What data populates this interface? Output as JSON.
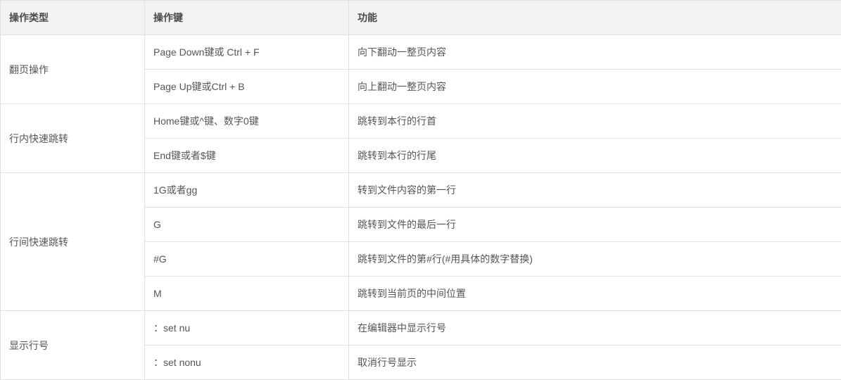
{
  "table": {
    "headers": {
      "type": "操作类型",
      "key": "操作键",
      "func": "功能"
    },
    "groups": [
      {
        "type": "翻页操作",
        "rows": [
          {
            "key": "Page Down键或 Ctrl + F",
            "func": "向下翻动一整页内容"
          },
          {
            "key": "Page Up键或Ctrl + B",
            "func": "向上翻动一整页内容"
          }
        ]
      },
      {
        "type": "行内快速跳转",
        "rows": [
          {
            "key": "Home键或^键、数字0键",
            "func": "跳转到本行的行首"
          },
          {
            "key": "End键或者$键",
            "func": "跳转到本行的行尾"
          }
        ]
      },
      {
        "type": "行间快速跳转",
        "rows": [
          {
            "key": "1G或者gg",
            "func": "转到文件内容的第一行"
          },
          {
            "key": "G",
            "func": "跳转到文件的最后一行"
          },
          {
            "key": "#G",
            "func": "跳转到文件的第#行(#用具体的数字替换)"
          },
          {
            "key": "M",
            "func": "跳转到当前页的中间位置"
          }
        ]
      },
      {
        "type": "显示行号",
        "rows": [
          {
            "key": "：set nu",
            "func": "在编辑器中显示行号"
          },
          {
            "key": "：set nonu",
            "func": "取消行号显示"
          }
        ]
      }
    ]
  }
}
